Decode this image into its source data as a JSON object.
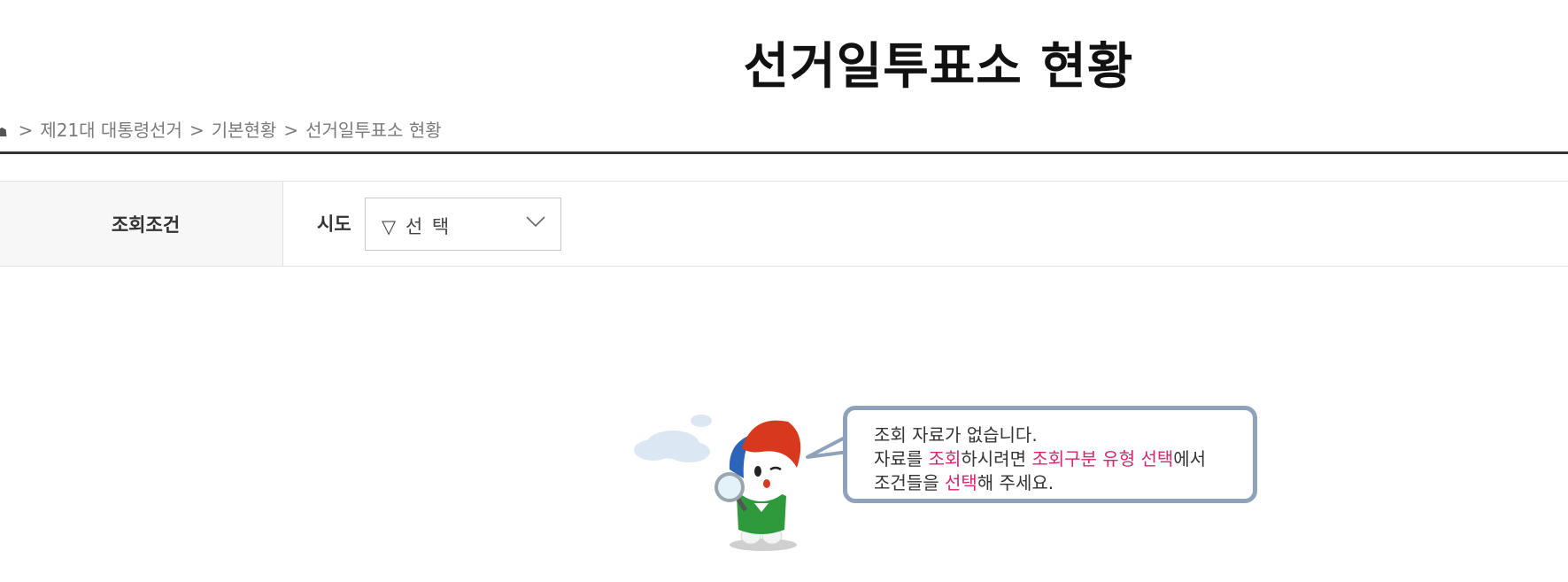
{
  "header": {
    "title": "선거일투표소 현황"
  },
  "breadcrumb": {
    "items": [
      "제21대 대통령선거",
      "기본현황",
      "선거일투표소 현황"
    ],
    "separator": ">"
  },
  "search": {
    "condition_label": "조회조건",
    "sido_label": "시도",
    "sido_selected": "▽ 선 택"
  },
  "empty_state": {
    "line1": "조회 자료가 없습니다.",
    "line2_a": "자료를 ",
    "line2_hl1": "조회",
    "line2_b": "하시려면 ",
    "line2_hl2": "조회구분 유형 선택",
    "line2_c": "에서",
    "line3_a": "조건들을 ",
    "line3_hl": "선택",
    "line3_b": "해 주세요."
  },
  "colors": {
    "highlight": "#d6266e",
    "bubble_border": "#8ea3bb",
    "rule": "#333333"
  },
  "icons": {
    "home": "home-icon",
    "select_arrow": "chevron-down-icon",
    "mascot": "mascot-illustration"
  }
}
